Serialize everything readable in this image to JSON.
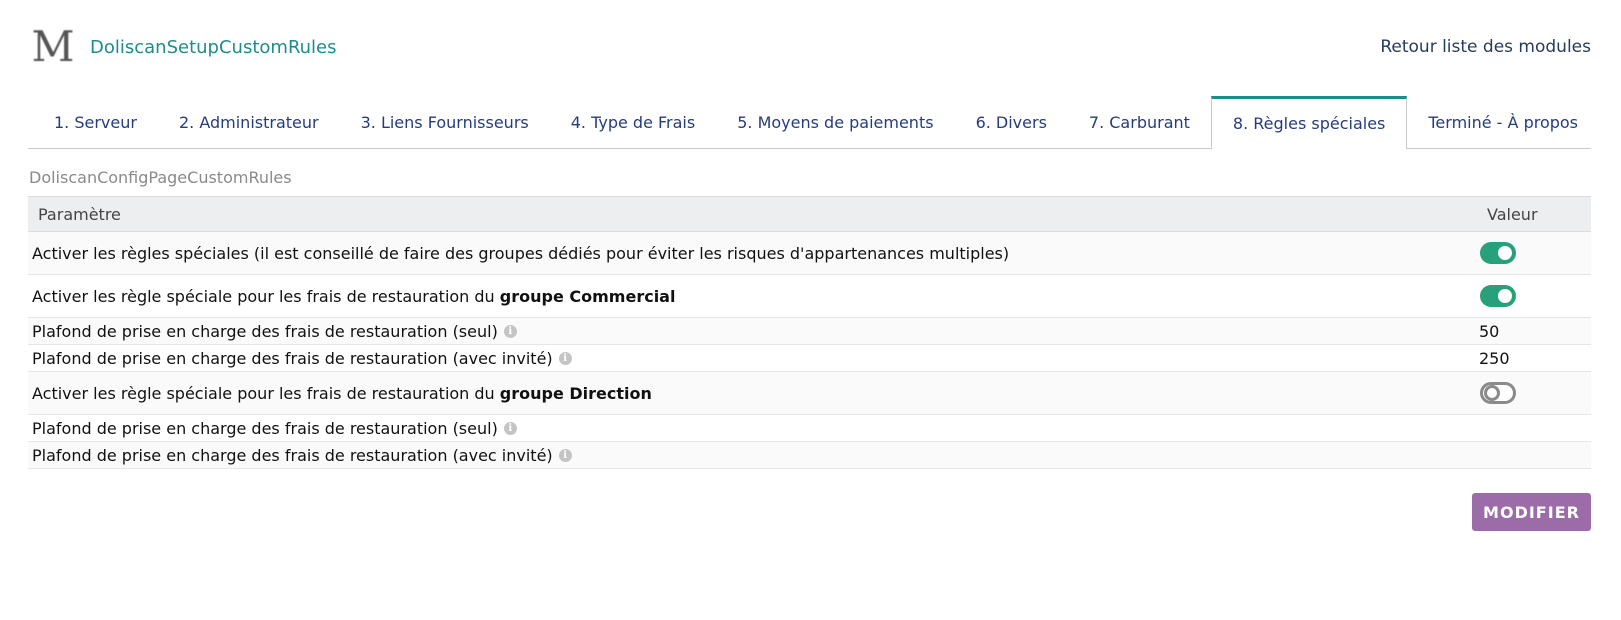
{
  "header": {
    "logo_letter": "M",
    "module_title": "DoliscanSetupCustomRules",
    "back_link": "Retour liste des modules"
  },
  "tabs": [
    {
      "label": "1. Serveur",
      "active": false
    },
    {
      "label": "2. Administrateur",
      "active": false
    },
    {
      "label": "3. Liens Fournisseurs",
      "active": false
    },
    {
      "label": "4. Type de Frais",
      "active": false
    },
    {
      "label": "5. Moyens de paiements",
      "active": false
    },
    {
      "label": "6. Divers",
      "active": false
    },
    {
      "label": "7. Carburant",
      "active": false
    },
    {
      "label": "8. Règles spéciales",
      "active": true
    },
    {
      "label": "Terminé - À propos",
      "active": false
    }
  ],
  "page_subtitle": "DoliscanConfigPageCustomRules",
  "table": {
    "col_param": "Paramètre",
    "col_value": "Valeur",
    "rows": {
      "r0": {
        "label": "Activer les règles spéciales (il est conseillé de faire des groupes dédiés pour éviter les risques d'appartenances multiples)",
        "toggle": "on"
      },
      "r1": {
        "label_prefix": "Activer les règle spéciale pour les frais de restauration du ",
        "label_bold": "groupe Commercial",
        "toggle": "on"
      },
      "r2": {
        "label": "Plafond de prise en charge des frais de restauration (seul)",
        "info_icon": "info-icon",
        "value": "50"
      },
      "r3": {
        "label": "Plafond de prise en charge des frais de restauration (avec invité)",
        "info_icon": "info-icon",
        "value": "250"
      },
      "r4": {
        "label_prefix": "Activer les règle spéciale pour les frais de restauration du ",
        "label_bold": "groupe Direction",
        "toggle": "off"
      },
      "r5": {
        "label": "Plafond de prise en charge des frais de restauration (seul)",
        "info_icon": "info-icon",
        "value": ""
      },
      "r6": {
        "label": "Plafond de prise en charge des frais de restauration (avec invité)",
        "info_icon": "info-icon",
        "value": ""
      }
    }
  },
  "info_glyph": "i",
  "buttons": {
    "modify": "MODIFIER"
  },
  "colors": {
    "accent_teal": "#1f8c8c",
    "toggle_on": "#28a07a",
    "toggle_off": "#8a8a8a",
    "button_purple": "#9b6ca8",
    "link_navy": "#263c7c"
  }
}
